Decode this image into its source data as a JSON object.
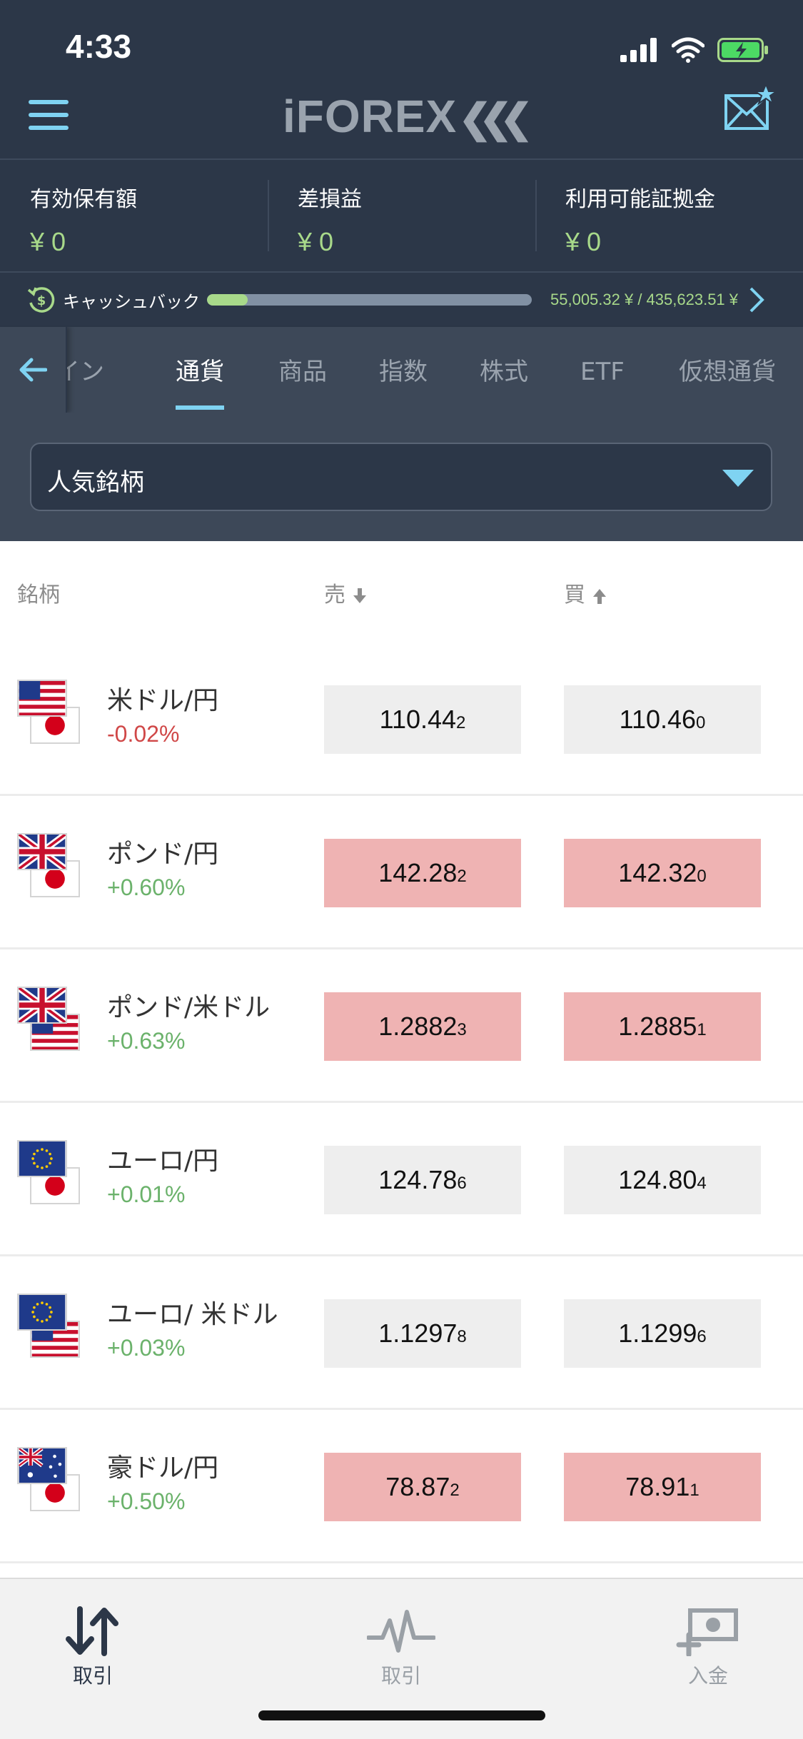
{
  "status_bar": {
    "time": "4:33"
  },
  "header": {
    "brand": "iFOREX"
  },
  "summary": [
    {
      "label": "有効保有額",
      "value": "¥ 0"
    },
    {
      "label": "差損益",
      "value": "¥ 0"
    },
    {
      "label": "利用可能証拠金",
      "value": "¥ 0"
    }
  ],
  "cashback": {
    "label": "キャッシュバック",
    "amount": "55,005.32 ¥ / 435,623.51 ¥",
    "progress": 0.126
  },
  "tabs": [
    {
      "label": "イン",
      "active": false
    },
    {
      "label": "通貨",
      "active": true
    },
    {
      "label": "商品",
      "active": false
    },
    {
      "label": "指数",
      "active": false
    },
    {
      "label": "株式",
      "active": false
    },
    {
      "label": "ETF",
      "active": false
    },
    {
      "label": "仮想通貨",
      "active": false
    }
  ],
  "filter": {
    "selected": "人気銘柄"
  },
  "columns": {
    "instrument": "銘柄",
    "sell": "売",
    "buy": "買"
  },
  "rows": [
    {
      "name": "米ドル/円",
      "change": "-0.02%",
      "sell": "110.44",
      "sell_tail": "2",
      "buy": "110.46",
      "buy_tail": "0"
    },
    {
      "name": "ポンド/円",
      "change": "+0.60%",
      "sell": "142.28",
      "sell_tail": "2",
      "buy": "142.32",
      "buy_tail": "0"
    },
    {
      "name": "ポンド/米ドル",
      "change": "+0.63%",
      "sell": "1.2882",
      "sell_tail": "3",
      "buy": "1.2885",
      "buy_tail": "1"
    },
    {
      "name": "ユーロ/円",
      "change": "+0.01%",
      "sell": "124.78",
      "sell_tail": "6",
      "buy": "124.80",
      "buy_tail": "4"
    },
    {
      "name": "ユーロ/ 米ドル",
      "change": "+0.03%",
      "sell": "1.1297",
      "sell_tail": "8",
      "buy": "1.1299",
      "buy_tail": "6"
    },
    {
      "name": "豪ドル/円",
      "change": "+0.50%",
      "sell": "78.87",
      "sell_tail": "2",
      "buy": "78.91",
      "buy_tail": "1"
    }
  ],
  "bottom_nav": [
    {
      "label": "取引",
      "icon": "trade-arrows-icon",
      "active": true
    },
    {
      "label": "取引",
      "icon": "pulse-icon",
      "active": false
    },
    {
      "label": "入金",
      "icon": "deposit-icon",
      "active": false
    }
  ],
  "colors": {
    "header_bg": "#2c3748",
    "tabs_bg": "#3d4858",
    "accent": "#7fd3f2",
    "positive": "#6bb26b",
    "negative": "#d04848",
    "price_down_bg": "#efb3b3",
    "price_neutral_bg": "#eeeeee"
  }
}
